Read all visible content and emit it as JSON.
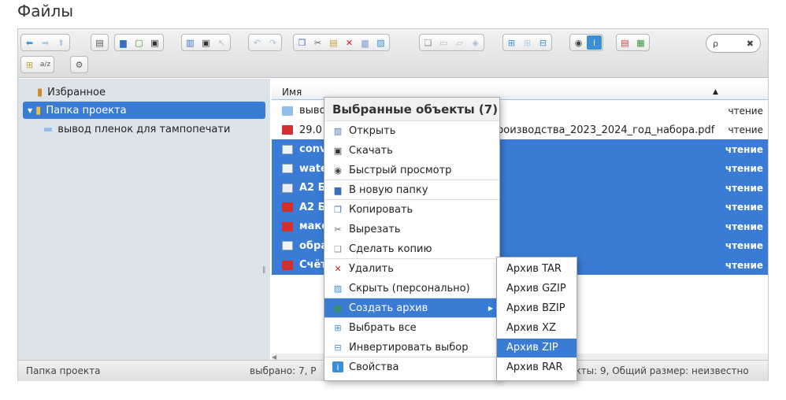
{
  "page_title": "Файлы",
  "toolbar": {
    "groups": [
      {
        "icons": [
          "back-icon",
          "forward-icon",
          "up-icon"
        ]
      },
      {
        "icons": [
          "netmount-icon"
        ]
      },
      {
        "icons": [
          "mkdir-icon",
          "mkfile-icon",
          "upload-icon"
        ]
      },
      {
        "icons": [
          "open-icon",
          "download-icon",
          "getfile-icon"
        ]
      },
      {
        "icons": [
          "undo-icon",
          "redo-icon"
        ]
      },
      {
        "icons": [
          "copy-icon",
          "cut-icon",
          "paste-icon",
          "delete-icon",
          "empty-icon",
          "hide-icon"
        ]
      },
      {
        "icons": [
          "duplicate-icon",
          "rename-icon",
          "edit-icon",
          "resize-icon"
        ]
      },
      {
        "icons": [
          "select-all-icon",
          "select-none-icon",
          "select-invert-icon"
        ]
      },
      {
        "icons": [
          "quicklook-icon",
          "info-icon"
        ]
      },
      {
        "icons": [
          "extract-icon",
          "archive-icon"
        ]
      },
      {
        "icons": [
          "view-icon",
          "sort-icon"
        ]
      },
      {
        "icons": [
          "preferences-icon"
        ]
      }
    ],
    "search_placeholder": "ρ",
    "search_clear": "✖"
  },
  "tree": {
    "items": [
      {
        "label": "Избранное",
        "icon": "favorites-icon"
      },
      {
        "label": "Папка проекта",
        "icon": "project-folder-icon",
        "selected": true
      },
      {
        "label": "вывод пленок для тампопечати",
        "icon": "folder-icon"
      }
    ]
  },
  "files": {
    "column_name": "Имя",
    "rows": [
      {
        "name": "вывод",
        "perm": "чтение",
        "icon": "folder-icon",
        "selected": false
      },
      {
        "name": "29.0",
        "name_tail": "роизводства_2023_2024_год_набора.pdf",
        "perm": "чтение",
        "icon": "pdf-icon",
        "selected": false
      },
      {
        "name": "conv",
        "perm": "чтение",
        "icon": "image-icon",
        "selected": true
      },
      {
        "name": "wate",
        "perm": "чтение",
        "icon": "image-icon",
        "selected": true
      },
      {
        "name": "A2 Б",
        "perm": "чтение",
        "icon": "file-icon",
        "selected": true
      },
      {
        "name": "A2 Б",
        "perm": "чтение",
        "icon": "pdf-icon",
        "selected": true
      },
      {
        "name": "маке",
        "perm": "чтение",
        "icon": "pdf-icon",
        "selected": true
      },
      {
        "name": "обра",
        "perm": "чтение",
        "icon": "image-icon",
        "selected": true
      },
      {
        "name": "Счёт",
        "perm": "чтение",
        "icon": "pdf-icon",
        "selected": true
      }
    ]
  },
  "status": {
    "path": "Папка проекта",
    "selected": "выбрано: 7, Р",
    "total": "екты: 9, Общий размер: неизвестно"
  },
  "context_menu": {
    "title": "Выбранные объекты (7)",
    "items": [
      {
        "label": "Открыть",
        "icon": "open-icon"
      },
      {
        "label": "Скачать",
        "icon": "download-icon"
      },
      {
        "label": "Быстрый просмотр",
        "icon": "quicklook-icon"
      },
      {
        "label": "В новую папку",
        "icon": "new-folder-icon"
      },
      {
        "label": "Копировать",
        "icon": "copy-icon"
      },
      {
        "label": "Вырезать",
        "icon": "cut-icon"
      },
      {
        "label": "Сделать копию",
        "icon": "duplicate-icon"
      },
      {
        "label": "Удалить",
        "icon": "delete-icon"
      },
      {
        "label": "Скрыть (персонально)",
        "icon": "hide-icon"
      },
      {
        "label": "Создать архив",
        "icon": "archive-icon",
        "active": true
      },
      {
        "label": "Выбрать все",
        "icon": "select-all-icon"
      },
      {
        "label": "Инвертировать выбор",
        "icon": "select-invert-icon"
      },
      {
        "label": "Свойства",
        "icon": "info-icon"
      }
    ]
  },
  "archive_submenu": {
    "items": [
      {
        "label": "Архив TAR"
      },
      {
        "label": "Архив GZIP"
      },
      {
        "label": "Архив BZIP"
      },
      {
        "label": "Архив XZ"
      },
      {
        "label": "Архив ZIP",
        "active": true
      },
      {
        "label": "Архив RAR"
      }
    ]
  },
  "colors": {
    "accent": "#3a7bd5",
    "pane_bg": "#dde3ea"
  }
}
